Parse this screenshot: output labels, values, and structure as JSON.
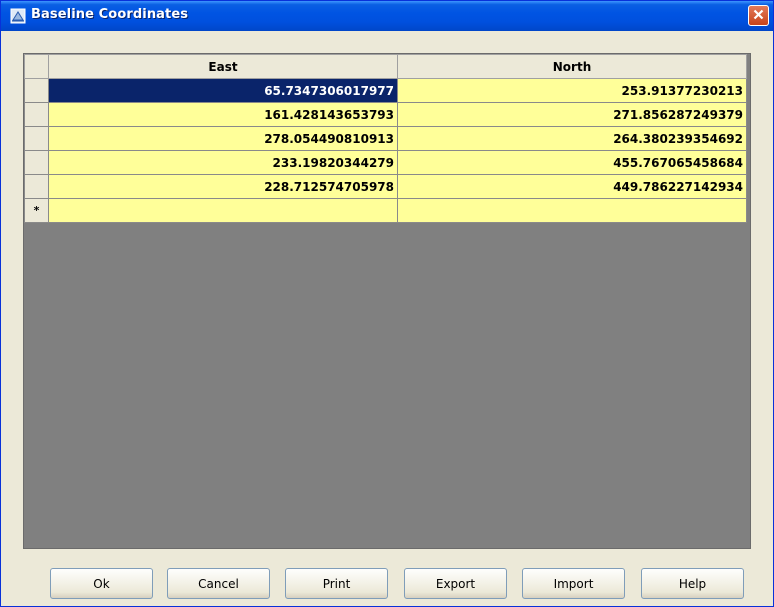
{
  "window": {
    "title": "Baseline Coordinates",
    "close_icon": "close-icon",
    "app_icon": "baseline-app-icon"
  },
  "grid": {
    "columns": [
      "East",
      "North"
    ],
    "rows": [
      {
        "east": "65.7347306017977",
        "north": "253.91377230213"
      },
      {
        "east": "161.428143653793",
        "north": "271.856287249379"
      },
      {
        "east": "278.054490810913",
        "north": "264.380239354692"
      },
      {
        "east": "233.19820344279",
        "north": "455.767065458684"
      },
      {
        "east": "228.712574705978",
        "north": "449.786227142934"
      }
    ],
    "new_row_marker": "*",
    "colors": {
      "cell_bg": "#ffff99",
      "selected_bg": "#0a246a",
      "empty_area": "#808080"
    }
  },
  "buttons": {
    "ok": "Ok",
    "cancel": "Cancel",
    "print": "Print",
    "export": "Export",
    "import": "Import",
    "help": "Help"
  }
}
